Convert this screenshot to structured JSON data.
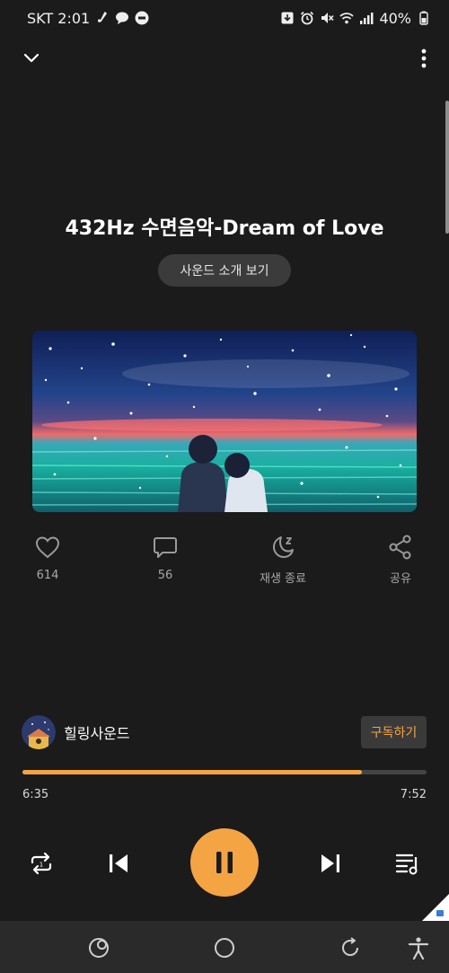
{
  "status_bar": {
    "carrier_time": "SKT 2:01",
    "battery": "40%",
    "left_icons": [
      "saxophone-icon",
      "chat-bubble-icon",
      "lock-app-icon"
    ],
    "right_icons": [
      "download-icon",
      "alarm-icon",
      "mute-icon",
      "wifi-icon",
      "signal-icon"
    ]
  },
  "player": {
    "title": "432Hz 수면음악-Dream of Love",
    "sound_info_label": "사운드 소개 보기",
    "actions": [
      {
        "icon": "heart-icon",
        "label": "614"
      },
      {
        "icon": "comment-icon",
        "label": "56"
      },
      {
        "icon": "sleep-timer-icon",
        "label": "재생 종료"
      },
      {
        "icon": "share-icon",
        "label": "공유"
      }
    ],
    "channel_name": "힐링사운드",
    "subscribe_label": "구독하기",
    "current_time": "6:35",
    "total_time": "7:52",
    "progress_fraction": 0.84
  },
  "colors": {
    "background": "#1b1b1b",
    "accent": "#f5a444",
    "chip": "#3b3b3b"
  }
}
